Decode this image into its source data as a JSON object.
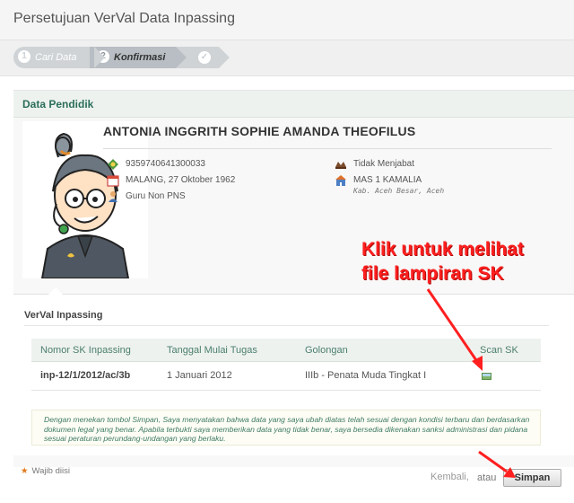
{
  "page": {
    "title": "Persetujuan VerVal Data Inpassing"
  },
  "wizard": {
    "steps": [
      {
        "num": "1",
        "label": "Cari Data"
      },
      {
        "num": "2",
        "label": "Konfirmasi"
      },
      {
        "label": ""
      }
    ],
    "done_glyph": "✓"
  },
  "section": {
    "title": "Data Pendidik"
  },
  "pendidik": {
    "name": "ANTONIA INGGRITH SOPHIE AMANDA THEOFILUS",
    "nuptk": "9359740641300033",
    "ttl": "MALANG, 27 Oktober 1962",
    "status": "Guru Non PNS",
    "jabatan": "Tidak Menjabat",
    "sekolah": "MAS 1 KAMALIA",
    "lokasi": "Kab. Aceh Besar, Aceh"
  },
  "verval": {
    "title": "VerVal Inpassing",
    "columns": [
      "Nomor SK Inpassing",
      "Tanggal Mulai Tugas",
      "Golongan",
      "Scan SK"
    ],
    "rows": [
      [
        "inp-12/1/2012/ac/3b",
        "1 Januari 2012",
        "IIIb - Penata Muda Tingkat I",
        ""
      ]
    ]
  },
  "disclaimer": "Dengan menekan tombol Simpan, Saya menyatakan bahwa data yang saya ubah diatas telah sesuai dengan kondisi terbaru dan berdasarkan dokumen legal yang benar. Apabila terbukti saya memberikan data yang tidak benar, saya bersedia dikenakan sanksi administrasi dan pidana sesuai peraturan perundang-undangan yang berlaku.",
  "footer": {
    "required_star": "★",
    "required_label": "Wajib diisi",
    "back_label": "Kembali,",
    "or_label": "atau",
    "save_label": "Simpan"
  },
  "annotation": {
    "line1": "Klik untuk melihat",
    "line2": "file lampiran SK",
    "color": "#ff1f1f"
  },
  "icons": {
    "nuptk": "id-card-icon",
    "birth": "calendar-icon",
    "status": "person-icon",
    "jabatan": "hat-icon",
    "sekolah": "school-icon"
  }
}
